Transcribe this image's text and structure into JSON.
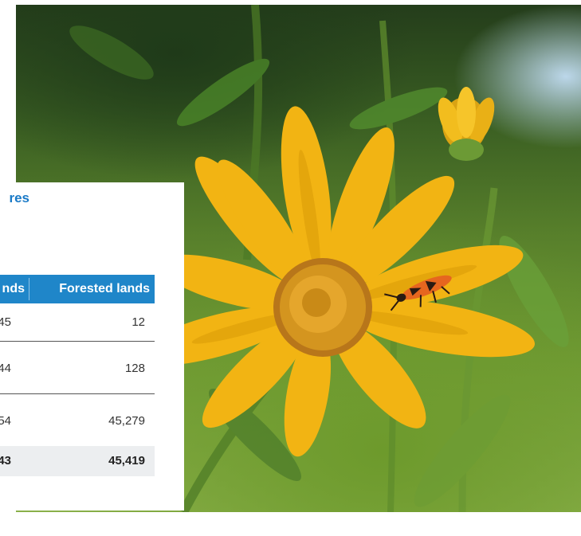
{
  "table": {
    "title_fragment": "res",
    "headers": [
      "nds",
      "Forested lands"
    ],
    "rows": [
      [
        "45",
        "12"
      ],
      [
        "44",
        "128"
      ],
      [
        "54",
        "45,279"
      ]
    ],
    "total": [
      "43",
      "45,419"
    ]
  },
  "photo": {
    "subject": "yellow-flower-with-bug",
    "colors": {
      "petal": "#f2b413",
      "petal_dark": "#d99b07",
      "center": "#c98a17",
      "bug": "#e6661f",
      "foliage": "#5c8a2c"
    }
  }
}
